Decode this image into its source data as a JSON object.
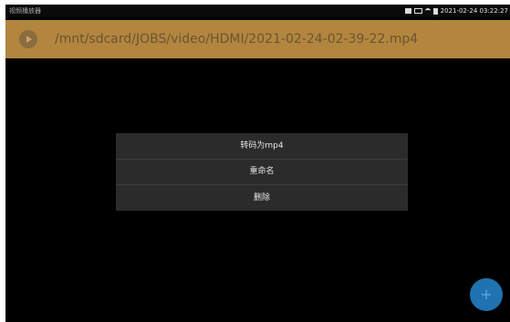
{
  "status_bar": {
    "app_title": "视频播放器",
    "datetime": "2021-02-24 03:22:27",
    "icons": [
      "notification-icon",
      "monitor-icon",
      "wifi-icon",
      "battery-icon"
    ]
  },
  "path_bar": {
    "play_icon": "play-circle-icon",
    "path": "/mnt/sdcard/JOBS/video/HDMI/2021-02-24-02-39-22.mp4"
  },
  "context_menu": {
    "items": [
      {
        "label": "转码为mp4"
      },
      {
        "label": "重命名"
      },
      {
        "label": "删除"
      }
    ]
  },
  "fab": {
    "icon": "plus-icon"
  },
  "colors": {
    "path_bar_bg": "#b2863f",
    "menu_bg": "#2b2b2b",
    "fab_bg": "#1e73b0",
    "screen_bg": "#000000"
  }
}
